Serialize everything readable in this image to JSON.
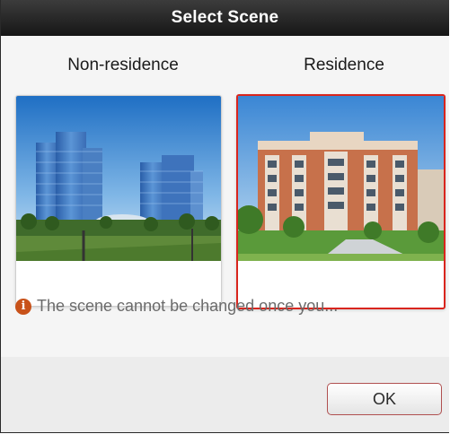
{
  "dialog": {
    "title": "Select Scene",
    "scenes": [
      {
        "label": "Non-residence",
        "selected": false
      },
      {
        "label": "Residence",
        "selected": true
      }
    ],
    "notice": "The scene cannot be changed once you...",
    "ok_label": "OK"
  },
  "colors": {
    "selection_border": "#d9251d",
    "titlebar": "#1f1f1f",
    "notice_icon": "#c8521a"
  },
  "icons": {
    "notice": "info-icon"
  }
}
